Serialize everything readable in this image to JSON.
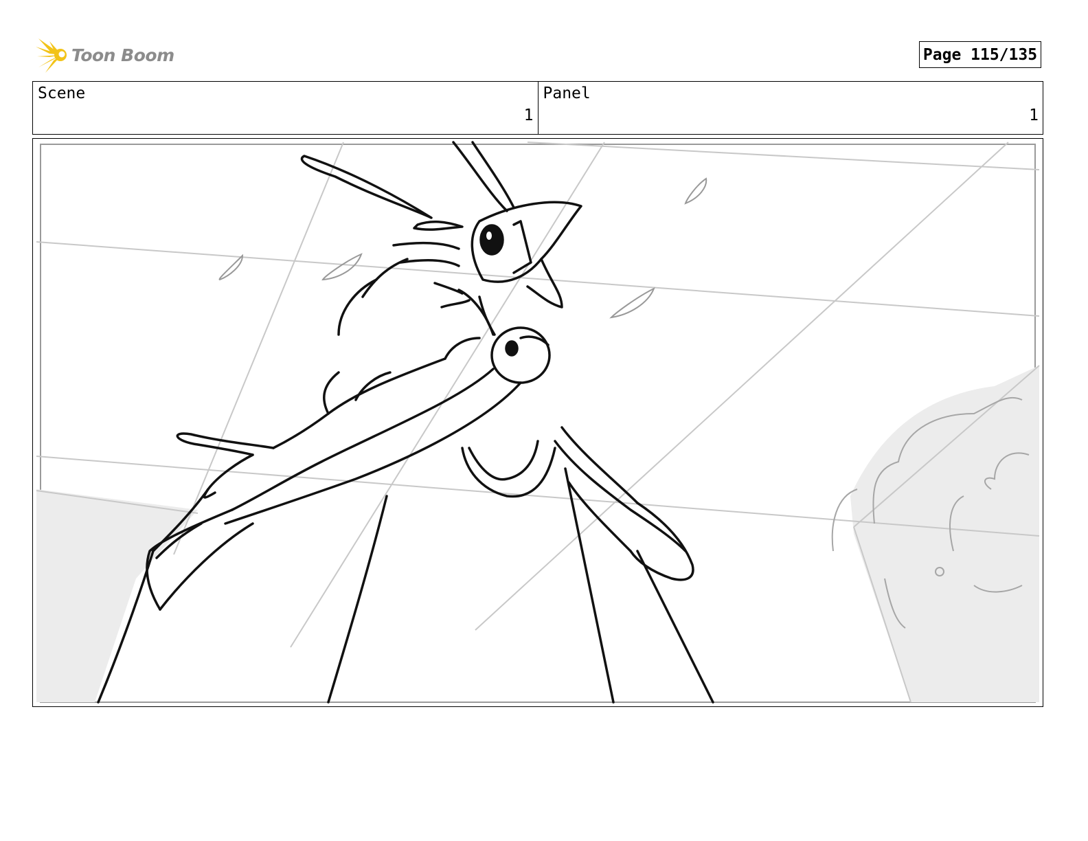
{
  "header": {
    "logo_text": "Toon Boom",
    "page_label": "Page 115/135"
  },
  "info": {
    "scene_label": "Scene",
    "scene_value": "1",
    "panel_label": "Panel",
    "panel_value": "1"
  },
  "colors": {
    "logo_sun": "#f2c318",
    "logo_text": "#8c8c8c",
    "sketch_line": "#111111",
    "guide_line": "#c8c8c8",
    "shadow_fill": "#ececec"
  }
}
